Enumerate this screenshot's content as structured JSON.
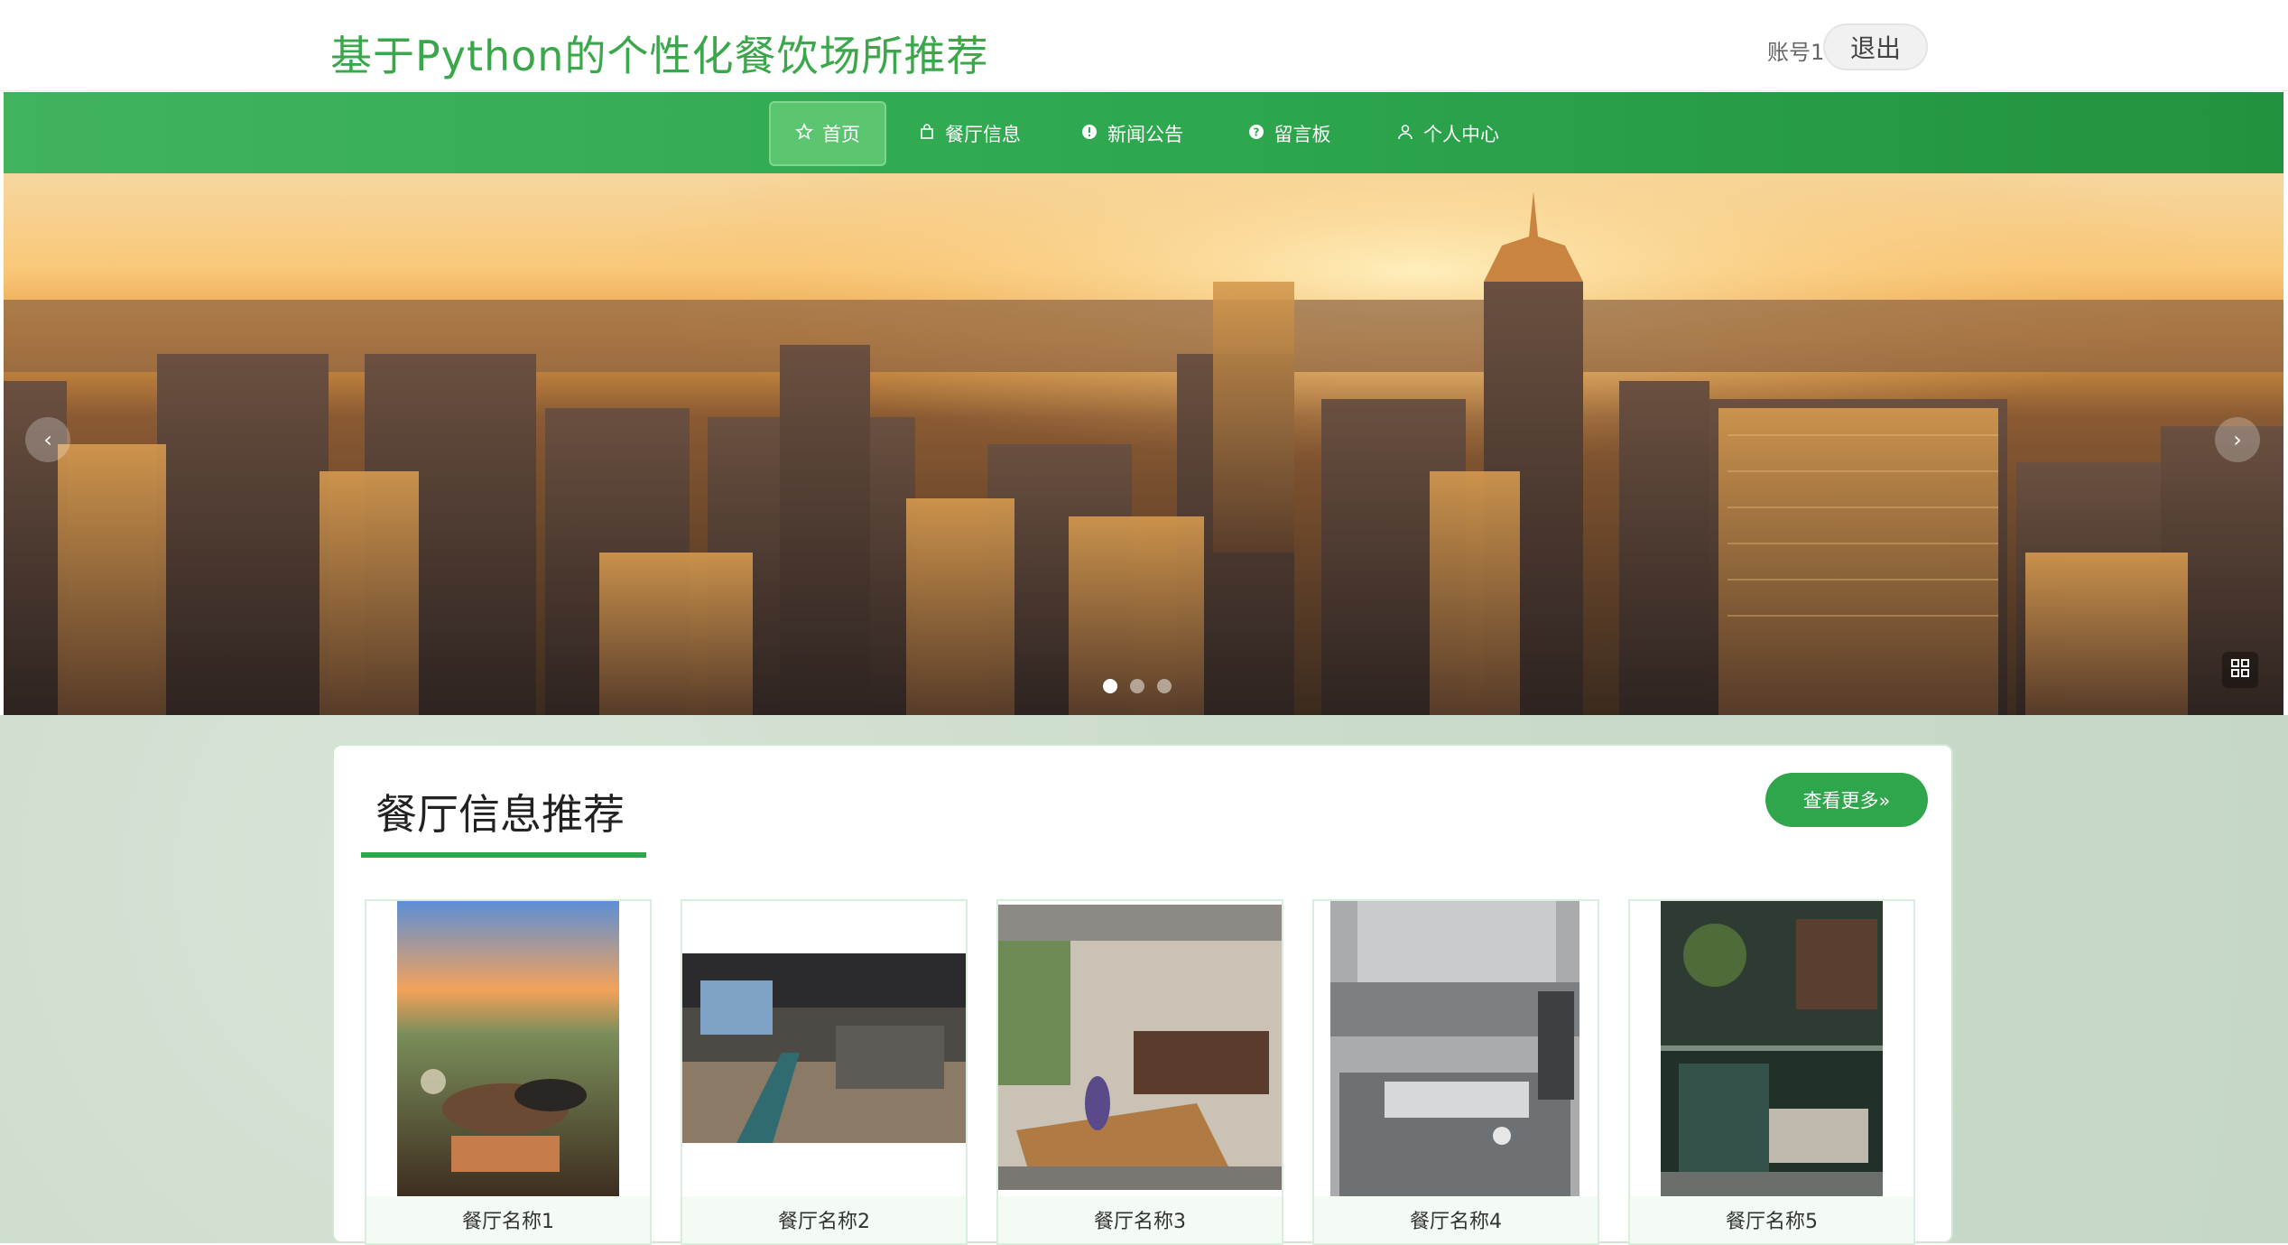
{
  "header": {
    "title": "基于Python的个性化餐饮场所推荐",
    "account": "账号1",
    "logout": "退出"
  },
  "nav": {
    "items": [
      {
        "label": "首页",
        "icon": "star-icon"
      },
      {
        "label": "餐厅信息",
        "icon": "bag-icon"
      },
      {
        "label": "新闻公告",
        "icon": "info-icon"
      },
      {
        "label": "留言板",
        "icon": "question-icon"
      },
      {
        "label": "个人中心",
        "icon": "user-icon"
      }
    ]
  },
  "banner": {
    "slides": 3,
    "active": 1
  },
  "section": {
    "title": "餐厅信息推荐",
    "more": "查看更多»"
  },
  "cards": [
    {
      "name": "餐厅名称1"
    },
    {
      "name": "餐厅名称2"
    },
    {
      "name": "餐厅名称3"
    },
    {
      "name": "餐厅名称4"
    },
    {
      "name": "餐厅名称5"
    }
  ],
  "colors": {
    "brand": "#2fa64c",
    "title": "#3aa84a"
  }
}
